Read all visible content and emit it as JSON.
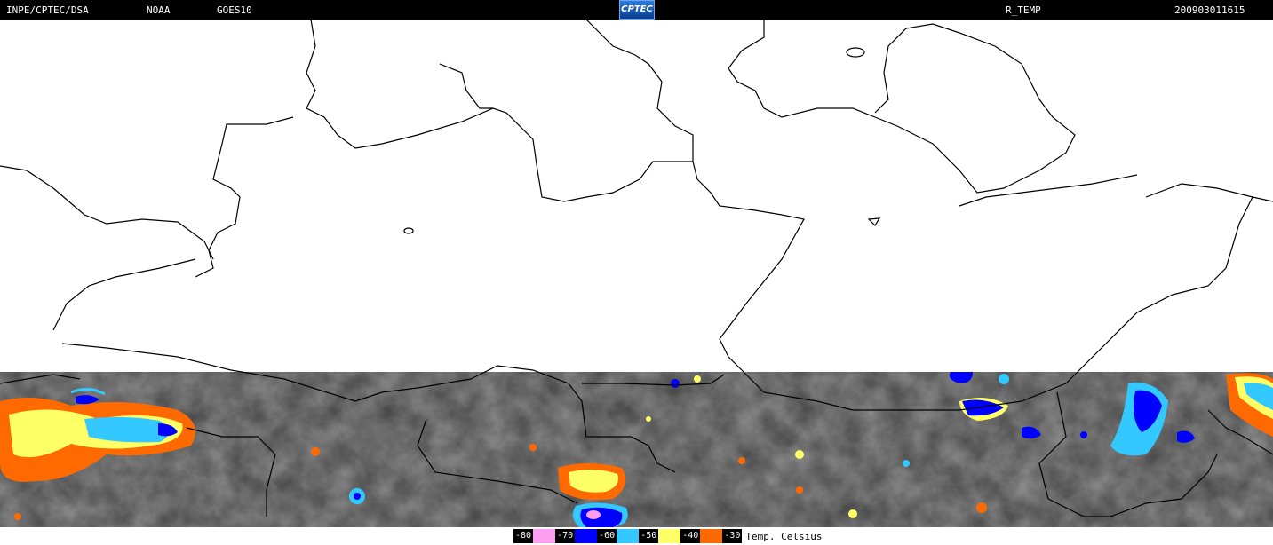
{
  "header": {
    "source": "INPE/CPTEC/DSA",
    "agency": "NOAA",
    "satellite": "GOES10",
    "logo_text": "CPTEC",
    "product": "R_TEMP",
    "timestamp": "200903011615"
  },
  "legend": {
    "unit": "Temp. Celsius",
    "items": [
      {
        "label": "-80",
        "color": "#ff9ef0"
      },
      {
        "label": "-70",
        "color": "#0000ff"
      },
      {
        "label": "-60",
        "color": "#33c8ff"
      },
      {
        "label": "-50",
        "color": "#ffff66"
      },
      {
        "label": "-40",
        "color": "#ff6a00"
      },
      {
        "label": "-30",
        "color": "#ff6a00"
      }
    ]
  },
  "colors": {
    "cloud_gray": "#5a5a5a",
    "border_line": "#000000",
    "map_background": "#ffffff"
  }
}
